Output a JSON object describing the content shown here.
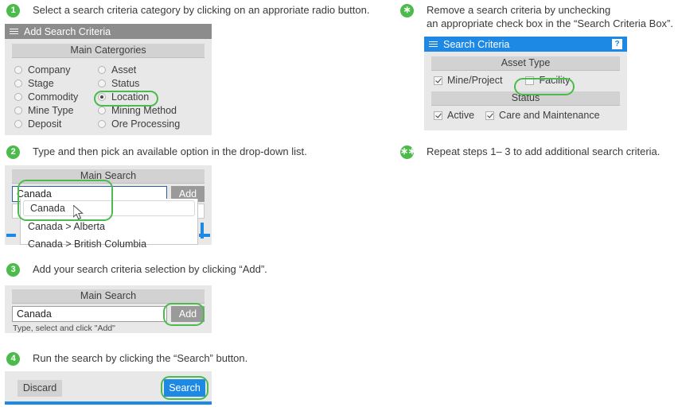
{
  "steps": [
    {
      "marker": "1",
      "text": "Select a search criteria category by clicking on an approriate radio button."
    },
    {
      "marker": "2",
      "text": "Type and then pick an available option in the drop-down list."
    },
    {
      "marker": "3",
      "text": "Add your search criteria selection by clicking “Add”."
    },
    {
      "marker": "4",
      "text": "Run the search by clicking the “Search” button."
    }
  ],
  "notes": [
    {
      "marker": "∗",
      "text": "Remove a search criteria by unchecking\nan appropriate check box in the “Search Criteria Box”."
    },
    {
      "marker": "∗∗",
      "text": "Repeat steps 1– 3 to add additional search criteria."
    }
  ],
  "add_criteria_panel": {
    "title": "Add Search Criteria",
    "section_title": "Main Catergories",
    "categories": [
      {
        "label": "Company",
        "selected": false
      },
      {
        "label": "Asset",
        "selected": false
      },
      {
        "label": "Stage",
        "selected": false
      },
      {
        "label": "Status",
        "selected": false
      },
      {
        "label": "Commodity",
        "selected": false
      },
      {
        "label": "Location",
        "selected": true
      },
      {
        "label": "Mine Type",
        "selected": false
      },
      {
        "label": "Mining Method",
        "selected": false
      },
      {
        "label": "Deposit",
        "selected": false
      },
      {
        "label": "Ore Processing",
        "selected": false
      }
    ]
  },
  "main_search_dropdown": {
    "section_title": "Main Search",
    "input_value": "Canada",
    "input_placeholder": "Type, select and click “Add”",
    "add_label": "Add",
    "options": [
      {
        "label": "Canada",
        "highlighted": true
      },
      {
        "label": "Canada > Alberta",
        "highlighted": false
      },
      {
        "label": "Canada > British Columbia",
        "highlighted": false
      }
    ]
  },
  "main_search_add": {
    "section_title": "Main Search",
    "input_value": "Canada",
    "add_label": "Add",
    "hint": "Type, select and click \"Add\""
  },
  "footer": {
    "discard_label": "Discard",
    "search_label": "Search"
  },
  "search_criteria_panel": {
    "title": "Search Criteria",
    "help_label": "?",
    "groups": [
      {
        "title": "Asset Type",
        "items": [
          {
            "label": "Mine/Project",
            "checked": true,
            "highlighted": false
          },
          {
            "label": "Facility",
            "checked": false,
            "highlighted": true
          }
        ]
      },
      {
        "title": "Status",
        "items": [
          {
            "label": "Active",
            "checked": true,
            "highlighted": false
          },
          {
            "label": "Care and Maintenance",
            "checked": true,
            "highlighted": false
          }
        ]
      }
    ]
  },
  "colors": {
    "accent_green": "#4cbb4c",
    "accent_blue": "#1e88e5",
    "panel_gray": "#e8e8e8",
    "header_gray": "#8c8c8c"
  }
}
